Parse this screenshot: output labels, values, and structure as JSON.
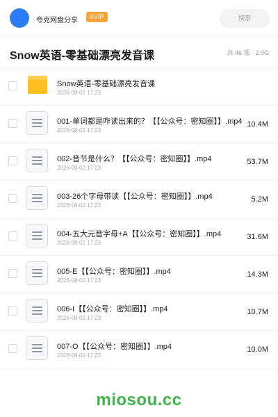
{
  "header": {
    "user_name": "夸克网盘分享",
    "vip_badge": "SVIP",
    "search_placeholder": "搜索"
  },
  "title_bar": {
    "title": "Snow英语-零基础漂亮发音课",
    "stats": "共 46 项 · 2.0G"
  },
  "files": [
    {
      "icon": "folder-icon",
      "name": "Snow英语-零基础漂亮发音课",
      "date": "2026-08-02 17:23",
      "size": ""
    },
    {
      "icon": "document-icon",
      "name": "001-单词都是咋读出来的？【【公众号：密知圈】】.mp4",
      "date": "2026-08-02 17:23",
      "size": "10.4M"
    },
    {
      "icon": "document-icon",
      "name": "002-音节是什么？【【公众号：密知圈】】.mp4",
      "date": "2026-08-02 17:23",
      "size": "53.7M"
    },
    {
      "icon": "document-icon",
      "name": "003-26个字母带读【【公众号：密知圈】】.mp4",
      "date": "2026-08-02 17:23",
      "size": "5.2M"
    },
    {
      "icon": "document-icon",
      "name": "004-五大元音字母+A【【公众号：密知圈】】.mp4",
      "date": "2026-08-02 17:23",
      "size": "31.6M"
    },
    {
      "icon": "document-icon",
      "name": "005-E【【公众号：密知圈】】.mp4",
      "date": "2026-08-02 17:23",
      "size": "14.3M"
    },
    {
      "icon": "document-icon",
      "name": "006-I【【公众号：密知圈】】.mp4",
      "date": "2026-08-02 17:23",
      "size": "10.7M"
    },
    {
      "icon": "document-icon",
      "name": "007-O【【公众号：密知圈】】.mp4",
      "date": "2026-08-02 17:23",
      "size": "10.0M"
    }
  ],
  "watermark": "miosou.cc",
  "colors": {
    "accent": "#2a7df6",
    "vip": "#f7a33a",
    "folder": "#ffbe1f",
    "watermark": "#3cb54a"
  }
}
